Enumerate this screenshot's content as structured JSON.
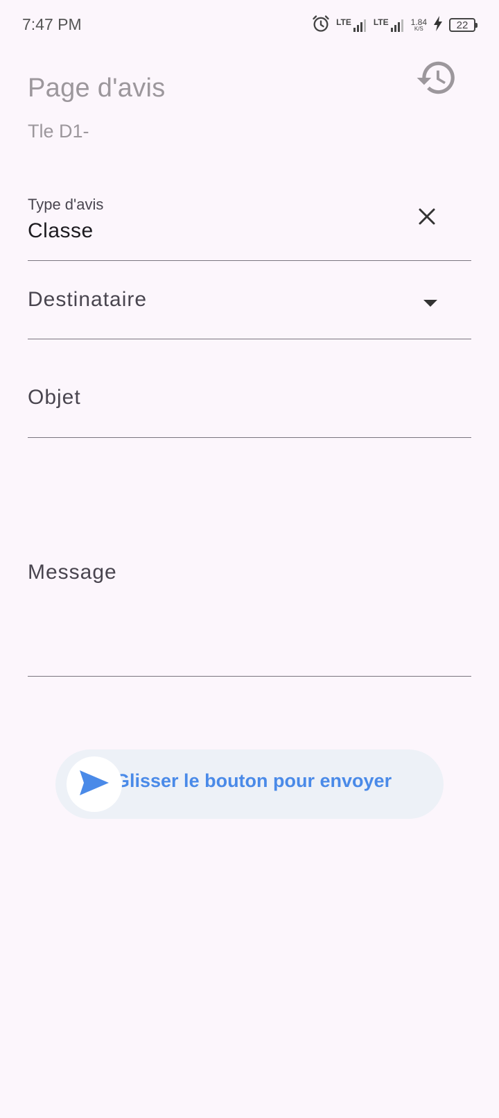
{
  "status_bar": {
    "time": "7:47 PM",
    "network_1": "LTE",
    "network_2": "LTE",
    "speed_value": "1.84",
    "speed_unit": "K/S",
    "battery": "22",
    "icons": [
      "alarm-icon",
      "lte-signal-icon",
      "lte-signal-icon",
      "charging-icon",
      "battery-icon"
    ]
  },
  "header": {
    "title": "Page d'avis",
    "subtitle": "Tle D1-",
    "history_icon": "history-icon"
  },
  "form": {
    "type_avis": {
      "label": "Type d'avis",
      "value": "Classe",
      "clear_icon": "close-icon"
    },
    "destinataire": {
      "placeholder": "Destinataire",
      "icon": "dropdown-arrow-icon"
    },
    "objet": {
      "placeholder": "Objet"
    },
    "message": {
      "placeholder": "Message"
    }
  },
  "send_slider": {
    "label": "Glisser le bouton pour envoyer",
    "icon": "send-icon",
    "accent": "#4a8ae8",
    "progress": 0
  },
  "colors": {
    "background": "#fcf6fc",
    "accent": "#4a8ae8",
    "muted_text": "#9c979c"
  }
}
